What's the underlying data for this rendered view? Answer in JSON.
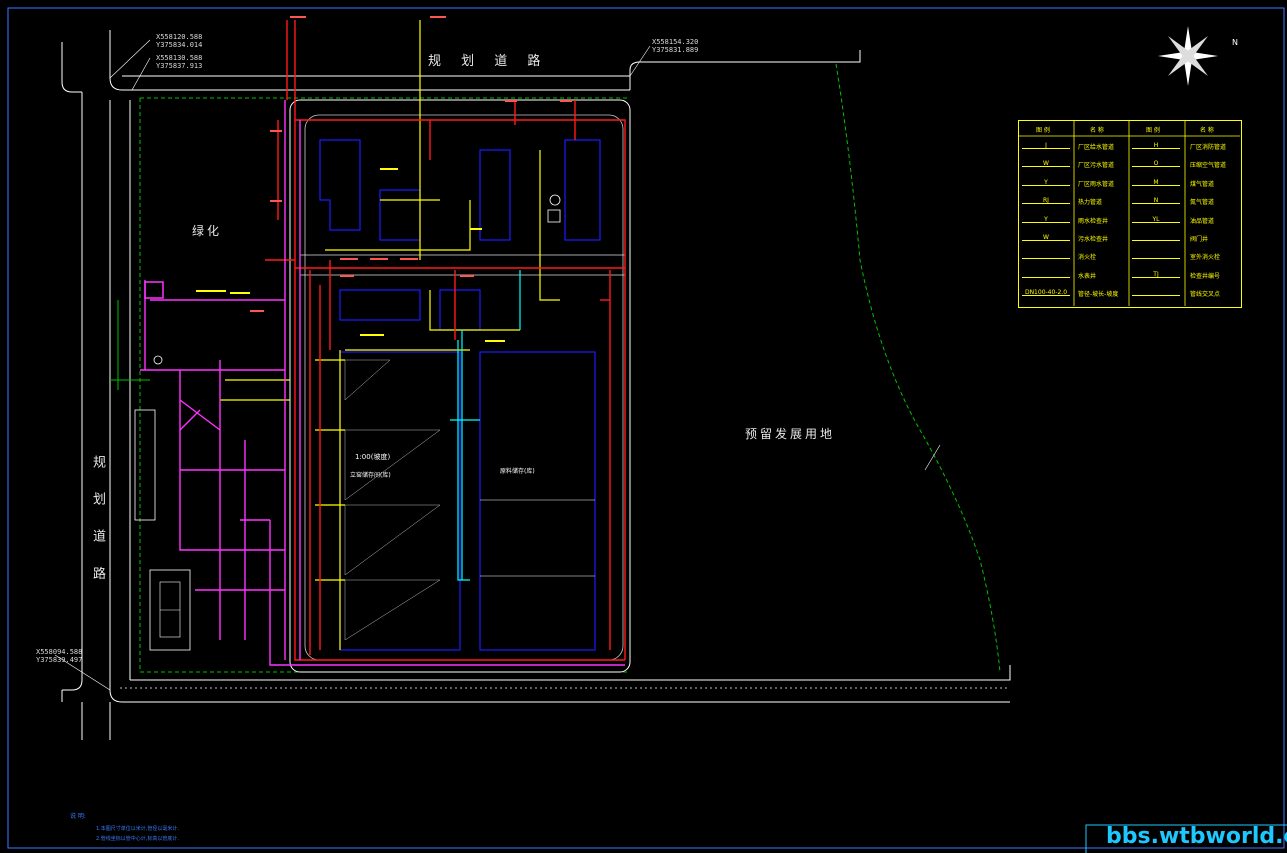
{
  "labels": {
    "road_top": "规 划 道 路",
    "road_left": "规 划 道 路",
    "greenery": "绿化",
    "reserved_area": "预留发展用地",
    "slope_note": "1:00(坡度)",
    "zone_a": "立窑储存间(库)",
    "zone_b": "原料储存(库)"
  },
  "coords": {
    "c1": [
      "X558120.588",
      "Y375834.014"
    ],
    "c2": [
      "X558130.588",
      "Y375837.913"
    ],
    "c3": [
      "X558154.320",
      "Y375831.889"
    ],
    "c4": [
      "X558094.588",
      "Y375839.497"
    ]
  },
  "legend": {
    "headers": [
      "图 例",
      "名 称",
      "图 例",
      "名 称"
    ],
    "rows": [
      [
        "J",
        "厂区给水管道",
        "H",
        "厂区消防管道"
      ],
      [
        "W",
        "厂区污水管道",
        "O",
        "压缩空气管道"
      ],
      [
        "Y",
        "厂区雨水管道",
        "M",
        "煤气管道"
      ],
      [
        "RJ",
        "热力管道",
        "N",
        "氮气管道"
      ],
      [
        "Y",
        "雨水检查井",
        "YL",
        "油品管道"
      ],
      [
        "W",
        "污水检查井",
        "",
        "阀门井"
      ],
      [
        "",
        "消火栓",
        "",
        "室外消火栓"
      ],
      [
        "",
        "水表井",
        "TJ",
        "检查井编号"
      ],
      [
        "DN100-40-2.0",
        "管径-坡长-坡度",
        "",
        "管线交叉点"
      ]
    ]
  },
  "notes": {
    "title": "说 明:",
    "items": [
      "1.本图尺寸单位以米计,管径以毫米计.",
      "2.管线坐标以管中心计,标高以管底计."
    ]
  },
  "watermark": "bbs.wtbworld.com",
  "compass_label": "N",
  "colors": {
    "background": "#000000",
    "road": "#ffffff",
    "site_boundary": "#00c000",
    "water_supply": "#ff1a1a",
    "fire_pipe": "#ff33ff",
    "storm": "#ffff00",
    "building": "#1a1aff",
    "cyan_pipe": "#00ffff"
  }
}
